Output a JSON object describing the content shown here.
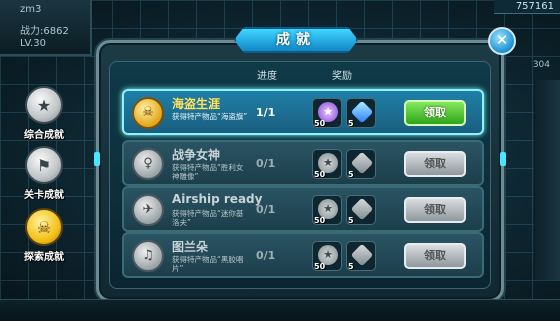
{
  "background": {
    "player_name": "zm3",
    "power": "战力:6862",
    "level": "LV.30",
    "currency": "757161",
    "side_number": "304"
  },
  "window": {
    "title": "成就",
    "close_icon": "close-icon",
    "columns": {
      "progress": "进度",
      "reward": "奖励"
    }
  },
  "categories": [
    {
      "label": "综合成就",
      "icon": "general-achievement-icon",
      "active": false
    },
    {
      "label": "关卡成就",
      "icon": "stage-achievement-icon",
      "active": false
    },
    {
      "label": "探索成就",
      "icon": "explore-achievement-icon",
      "active": true
    }
  ],
  "achievements": [
    {
      "name": "海盗生涯",
      "desc": "获得特产物品“海盗旗”",
      "progress": "1/1",
      "reward1_count": "50",
      "reward2_count": "5",
      "claim_label": "领取",
      "active": true
    },
    {
      "name": "战争女神",
      "desc": "获得特产物品“胜利女神雕像”",
      "progress": "0/1",
      "reward1_count": "50",
      "reward2_count": "5",
      "claim_label": "领取",
      "active": false
    },
    {
      "name": "Airship ready",
      "desc": "获得特产物品“迷你基洛夫”",
      "progress": "0/1",
      "reward1_count": "50",
      "reward2_count": "5",
      "claim_label": "领取",
      "active": false
    },
    {
      "name": "图兰朵",
      "desc": "获得特产物品“黑胶唱片”",
      "progress": "0/1",
      "reward1_count": "50",
      "reward2_count": "5",
      "claim_label": "领取",
      "active": false
    }
  ],
  "colors": {
    "claim_active": "#3dbb24",
    "title_tab": "#23a7e6",
    "highlight_row": "#8ff3ff"
  }
}
